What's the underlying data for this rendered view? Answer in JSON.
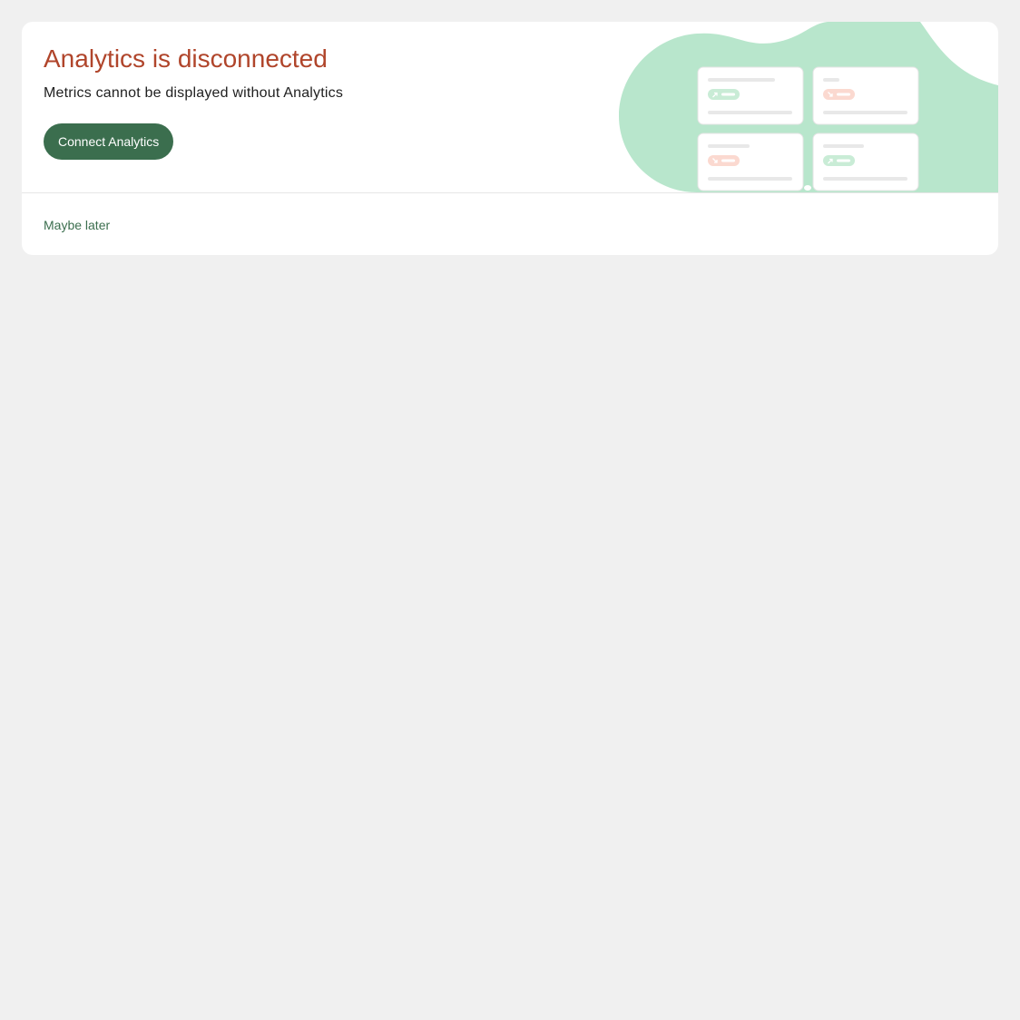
{
  "banner": {
    "title": "Analytics is disconnected",
    "subtitle": "Metrics cannot be displayed without Analytics",
    "connect_label": "Connect Analytics",
    "dismiss_label": "Maybe later"
  },
  "illustration": {
    "blob_color": "#b8e6cc",
    "up_badge_color": "#c9ecd6",
    "down_badge_color": "#fbd9d0",
    "tiles": [
      {
        "trend": "up",
        "trend_icon": "arrow-up-right-icon"
      },
      {
        "trend": "down",
        "trend_icon": "arrow-down-right-icon"
      },
      {
        "trend": "down",
        "trend_icon": "arrow-down-right-icon"
      },
      {
        "trend": "up",
        "trend_icon": "arrow-up-right-icon"
      }
    ]
  },
  "colors": {
    "title": "#b0452b",
    "accent": "#3b6e4e",
    "page_background": "#f0f0f0"
  }
}
